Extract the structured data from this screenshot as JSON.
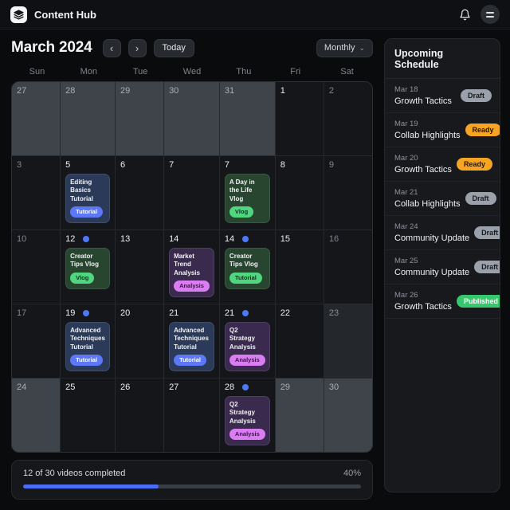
{
  "app": {
    "title": "Content Hub"
  },
  "icons": {
    "logo": "layers-icon",
    "notifications": "bell-icon",
    "menu": "hamburger-icon",
    "prev_glyph": "‹",
    "next_glyph": "›",
    "caret_glyph": "⌄"
  },
  "toolbar": {
    "month_label": "March 2024",
    "today_label": "Today",
    "view_label": "Monthly"
  },
  "calendar": {
    "day_headers": [
      "Sun",
      "Mon",
      "Tue",
      "Wed",
      "Thu",
      "Fri",
      "Sat"
    ],
    "weeks": [
      {
        "days": [
          {
            "num": "27",
            "tone": "light",
            "dim": true,
            "dot": false,
            "event": null
          },
          {
            "num": "28",
            "tone": "light",
            "dim": true,
            "dot": false,
            "event": null
          },
          {
            "num": "29",
            "tone": "light",
            "dim": true,
            "dot": false,
            "event": null
          },
          {
            "num": "30",
            "tone": "light",
            "dim": true,
            "dot": false,
            "event": null
          },
          {
            "num": "31",
            "tone": "light",
            "dim": true,
            "dot": false,
            "event": null
          },
          {
            "num": "1",
            "tone": "dark",
            "dim": false,
            "dot": false,
            "event": null
          },
          {
            "num": "2",
            "tone": "dark",
            "dim": true,
            "dot": false,
            "event": null
          }
        ]
      },
      {
        "days": [
          {
            "num": "3",
            "tone": "dark",
            "dim": true,
            "dot": false,
            "event": null
          },
          {
            "num": "5",
            "tone": "dark",
            "dim": false,
            "dot": false,
            "event": {
              "title": "Editing Basics Tutorial",
              "tag": "Tutorial",
              "variant": "blue"
            }
          },
          {
            "num": "6",
            "tone": "dark",
            "dim": false,
            "dot": false,
            "event": null
          },
          {
            "num": "7",
            "tone": "dark",
            "dim": false,
            "dot": false,
            "event": null
          },
          {
            "num": "7",
            "tone": "dark",
            "dim": false,
            "dot": false,
            "event": {
              "title": "A Day in the Life Vlog",
              "tag": "Vlog",
              "variant": "green"
            }
          },
          {
            "num": "8",
            "tone": "dark",
            "dim": false,
            "dot": false,
            "event": null
          },
          {
            "num": "9",
            "tone": "dark",
            "dim": true,
            "dot": false,
            "event": null
          }
        ]
      },
      {
        "days": [
          {
            "num": "10",
            "tone": "dark",
            "dim": true,
            "dot": false,
            "event": null
          },
          {
            "num": "12",
            "tone": "dark",
            "dim": false,
            "dot": true,
            "event": {
              "title": "Creator Tips Vlog",
              "tag": "Vlog",
              "variant": "green"
            }
          },
          {
            "num": "13",
            "tone": "dark",
            "dim": false,
            "dot": false,
            "event": null
          },
          {
            "num": "14",
            "tone": "dark",
            "dim": false,
            "dot": false,
            "event": {
              "title": "Market Trend Analysis",
              "tag": "Analysis",
              "variant": "purple"
            }
          },
          {
            "num": "14",
            "tone": "dark",
            "dim": false,
            "dot": true,
            "event": {
              "title": "Creator Tips Vlog",
              "tag": "Tutorial",
              "variant": "green"
            }
          },
          {
            "num": "15",
            "tone": "dark",
            "dim": false,
            "dot": false,
            "event": null
          },
          {
            "num": "16",
            "tone": "dark",
            "dim": true,
            "dot": false,
            "event": null
          }
        ]
      },
      {
        "days": [
          {
            "num": "17",
            "tone": "dark",
            "dim": true,
            "dot": false,
            "event": null
          },
          {
            "num": "19",
            "tone": "dark",
            "dim": false,
            "dot": true,
            "event": {
              "title": "Advanced Techniques Tutorial",
              "tag": "Tutorial",
              "variant": "blue"
            }
          },
          {
            "num": "20",
            "tone": "dark",
            "dim": false,
            "dot": false,
            "event": null
          },
          {
            "num": "21",
            "tone": "dark",
            "dim": false,
            "dot": false,
            "event": {
              "title": "Advanced Techniques Tutorial",
              "tag": "Tutorial",
              "variant": "blue"
            }
          },
          {
            "num": "21",
            "tone": "dark",
            "dim": false,
            "dot": true,
            "event": {
              "title": "Q2 Strategy Analysis",
              "tag": "Analysis",
              "variant": "purple"
            }
          },
          {
            "num": "22",
            "tone": "dark",
            "dim": false,
            "dot": false,
            "event": null
          },
          {
            "num": "23",
            "tone": "medium",
            "dim": true,
            "dot": false,
            "event": null
          }
        ]
      },
      {
        "days": [
          {
            "num": "24",
            "tone": "light",
            "dim": true,
            "dot": false,
            "event": null
          },
          {
            "num": "25",
            "tone": "dark",
            "dim": false,
            "dot": false,
            "event": null
          },
          {
            "num": "26",
            "tone": "dark",
            "dim": false,
            "dot": false,
            "event": null
          },
          {
            "num": "27",
            "tone": "dark",
            "dim": false,
            "dot": false,
            "event": null
          },
          {
            "num": "28",
            "tone": "dark",
            "dim": false,
            "dot": true,
            "event": {
              "title": "Q2 Strategy Analysis",
              "tag": "Analysis",
              "variant": "purple"
            }
          },
          {
            "num": "29",
            "tone": "light",
            "dim": true,
            "dot": false,
            "event": null
          },
          {
            "num": "30",
            "tone": "light",
            "dim": true,
            "dot": false,
            "event": null
          }
        ]
      }
    ]
  },
  "sidebar": {
    "title": "Upcoming Schedule",
    "items": [
      {
        "date": "Mar 18",
        "title": "Growth Tactics",
        "status": "Draft",
        "variant": "draft"
      },
      {
        "date": "Mar 19",
        "title": "Collab Highlights",
        "status": "Ready",
        "variant": "ready"
      },
      {
        "date": "Mar 20",
        "title": "Growth Tactics",
        "status": "Ready",
        "variant": "ready"
      },
      {
        "date": "Mar 21",
        "title": "Collab Highlights",
        "status": "Draft",
        "variant": "draft"
      },
      {
        "date": "Mar 24",
        "title": "Community Update",
        "status": "Draft",
        "variant": "draft"
      },
      {
        "date": "Mar 25",
        "title": "Community Update",
        "status": "Draft",
        "variant": "draft"
      },
      {
        "date": "Mar 26",
        "title": "Growth Tactics",
        "status": "Published",
        "variant": "published"
      }
    ]
  },
  "progress": {
    "label": "12 of 30 videos completed",
    "percent": 40,
    "percent_label": "40%"
  },
  "colors": {
    "accent_blue": "#4a6df8",
    "pill_blue": "#5c78f7",
    "pill_green": "#4fd67f",
    "pill_purple": "#da7cf2",
    "badge_orange": "#f5a522",
    "badge_green": "#35c96c",
    "badge_gray": "#9aa1ab"
  }
}
